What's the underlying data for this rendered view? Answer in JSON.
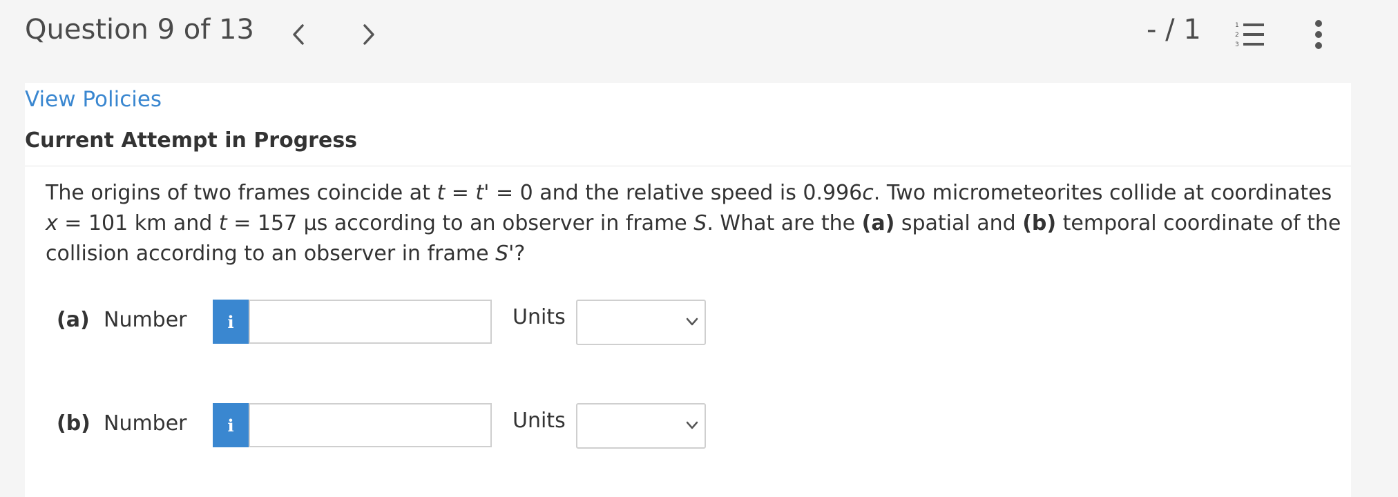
{
  "header": {
    "title": "Question 9 of 13",
    "score": "- / 1",
    "icons": {
      "prev": "chevron-left-icon",
      "next": "chevron-right-icon",
      "list": "numbered-list-icon",
      "more": "more-vertical-icon"
    }
  },
  "main": {
    "policies_link": "View Policies",
    "attempt_heading": "Current Attempt in Progress",
    "question": {
      "t1": "The origins of two frames coincide at ",
      "v_t": "t",
      "t2": " = ",
      "v_tp": "t'",
      "t3": " = 0 and the relative speed is 0.996",
      "v_c": "c",
      "t4": ". Two micrometeorites collide at coordinates ",
      "v_x": "x",
      "t5": " = 101 km and ",
      "v_t2": "t",
      "t6": " = 157 μs according to an observer in frame ",
      "v_S": "S",
      "t7": ". What are the ",
      "b_a": "(a)",
      "t8": " spatial and ",
      "b_b": "(b)",
      "t9": " temporal coordinate of the collision according to an observer in frame ",
      "v_Sp": "S'",
      "t10": "?"
    },
    "parts": [
      {
        "label": "(a)",
        "number_label": "Number",
        "info_glyph": "i",
        "value": "",
        "units_label": "Units",
        "units_selected": ""
      },
      {
        "label": "(b)",
        "number_label": "Number",
        "info_glyph": "i",
        "value": "",
        "units_label": "Units",
        "units_selected": ""
      }
    ]
  },
  "colors": {
    "accent": "#3a87d0",
    "background": "#f5f5f5",
    "card": "#ffffff",
    "text": "#333333"
  }
}
